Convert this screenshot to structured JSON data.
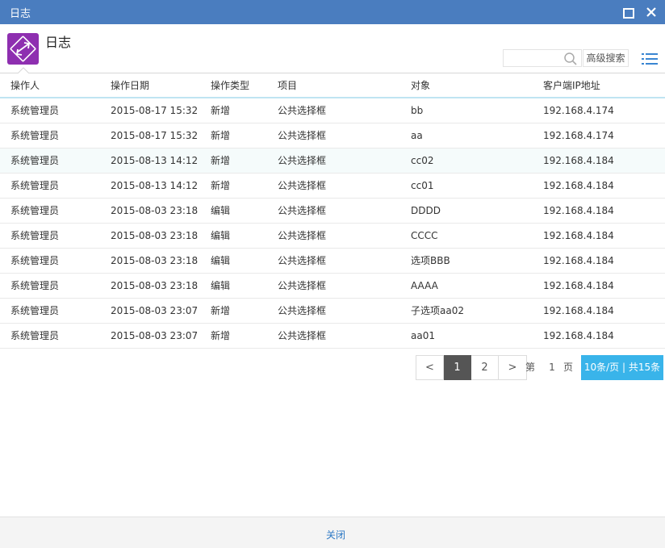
{
  "window": {
    "title": "日志"
  },
  "header": {
    "app_title": "日志",
    "search_placeholder": "",
    "advanced_search_label": "高级搜索"
  },
  "table": {
    "columns": [
      "操作人",
      "操作日期",
      "操作类型",
      "项目",
      "对象",
      "客户端IP地址"
    ],
    "rows": [
      [
        "系统管理员",
        "2015-08-17 15:32",
        "新增",
        "公共选择框",
        "bb",
        "192.168.4.174"
      ],
      [
        "系统管理员",
        "2015-08-17 15:32",
        "新增",
        "公共选择框",
        "aa",
        "192.168.4.174"
      ],
      [
        "系统管理员",
        "2015-08-13 14:12",
        "新增",
        "公共选择框",
        "cc02",
        "192.168.4.184"
      ],
      [
        "系统管理员",
        "2015-08-13 14:12",
        "新增",
        "公共选择框",
        "cc01",
        "192.168.4.184"
      ],
      [
        "系统管理员",
        "2015-08-03 23:18",
        "编辑",
        "公共选择框",
        "DDDD",
        "192.168.4.184"
      ],
      [
        "系统管理员",
        "2015-08-03 23:18",
        "编辑",
        "公共选择框",
        "CCCC",
        "192.168.4.184"
      ],
      [
        "系统管理员",
        "2015-08-03 23:18",
        "编辑",
        "公共选择框",
        "选项BBB",
        "192.168.4.184"
      ],
      [
        "系统管理员",
        "2015-08-03 23:18",
        "编辑",
        "公共选择框",
        "AAAA",
        "192.168.4.184"
      ],
      [
        "系统管理员",
        "2015-08-03 23:07",
        "新增",
        "公共选择框",
        "子选项aa02",
        "192.168.4.184"
      ],
      [
        "系统管理员",
        "2015-08-03 23:07",
        "新增",
        "公共选择框",
        "aa01",
        "192.168.4.184"
      ]
    ]
  },
  "pager": {
    "prev_label": "<",
    "pages": [
      "1",
      "2"
    ],
    "current_page": "1",
    "next_label": ">",
    "goto_prefix": "第",
    "goto_value": "1",
    "goto_suffix": "页",
    "info": "10条/页 | 共15条"
  },
  "footer": {
    "close_label": "关闭"
  },
  "colors": {
    "titlebar": "#4a7dbf",
    "logo": "#8e2fb0",
    "active_page": "#555555",
    "page_info": "#39b4ea",
    "link": "#2c78c4"
  }
}
